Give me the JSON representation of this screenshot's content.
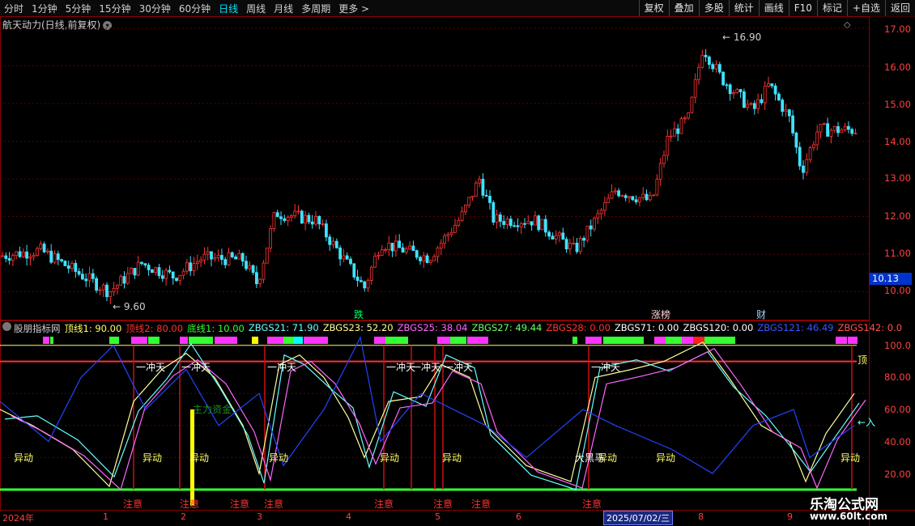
{
  "toolbar": {
    "tabs": [
      "分时",
      "1分钟",
      "5分钟",
      "15分钟",
      "30分钟",
      "60分钟",
      "日线",
      "周线",
      "月线",
      "多周期",
      "更多 >"
    ],
    "active_tab": "日线",
    "right_buttons": [
      "复权",
      "叠加",
      "多股",
      "统计",
      "画线",
      "F10",
      "标记",
      "+自选",
      "返回"
    ]
  },
  "main": {
    "title": "航天动力(日线,前复权)",
    "high_label": "16.90",
    "low_label": "9.60",
    "current_price": "10.13",
    "markers": [
      {
        "text": "跌",
        "color": "#00ff66"
      },
      {
        "text": "涨榜",
        "color": "#ffd0d0"
      },
      {
        "text": "财",
        "color": "#9fd0ff"
      }
    ]
  },
  "indicator": {
    "name": "股朋指标网",
    "values": [
      {
        "text": "顶线1: 90.00",
        "color": "#ffff66"
      },
      {
        "text": "顶线2: 80.00",
        "color": "#ff3030"
      },
      {
        "text": "底线1: 10.00",
        "color": "#33ff33"
      },
      {
        "text": "ZBGS21: 71.90",
        "color": "#66ffff"
      },
      {
        "text": "ZBGS23: 52.20",
        "color": "#ffff99"
      },
      {
        "text": "ZBGS25: 38.04",
        "color": "#ff66ff"
      },
      {
        "text": "ZBGS27: 49.44",
        "color": "#66ff66"
      },
      {
        "text": "ZBGS28: 0.00",
        "color": "#ff3030"
      },
      {
        "text": "ZBGS71: 0.00",
        "color": "#ffffff"
      },
      {
        "text": "ZBGS120: 0.00",
        "color": "#ffffff"
      },
      {
        "text": "ZBGS121: 46.49",
        "color": "#3355ff"
      },
      {
        "text": "ZBGS142: 0.0",
        "color": "#ff5050"
      }
    ],
    "labels": {
      "yidong": "异动",
      "zhuyi": "注意",
      "yichongtian": "一冲天",
      "heima": "大黑马",
      "zhuli": "主力资金",
      "ding": "顶",
      "ru": "入"
    }
  },
  "price_axis": [
    "17.00",
    "16.00",
    "15.00",
    "14.00",
    "13.00",
    "12.00",
    "11.00",
    "10.00"
  ],
  "ind_axis": [
    "100.0",
    "80.00",
    "60.00",
    "40.00",
    "20.00"
  ],
  "dates": [
    "2024年",
    "1",
    "2",
    "3",
    "4",
    "5",
    "6",
    "8",
    "9"
  ],
  "date_highlight": "2025/07/02/三",
  "watermark": {
    "line1": "乐淘公式网",
    "line2": "www.60lt.com"
  }
}
